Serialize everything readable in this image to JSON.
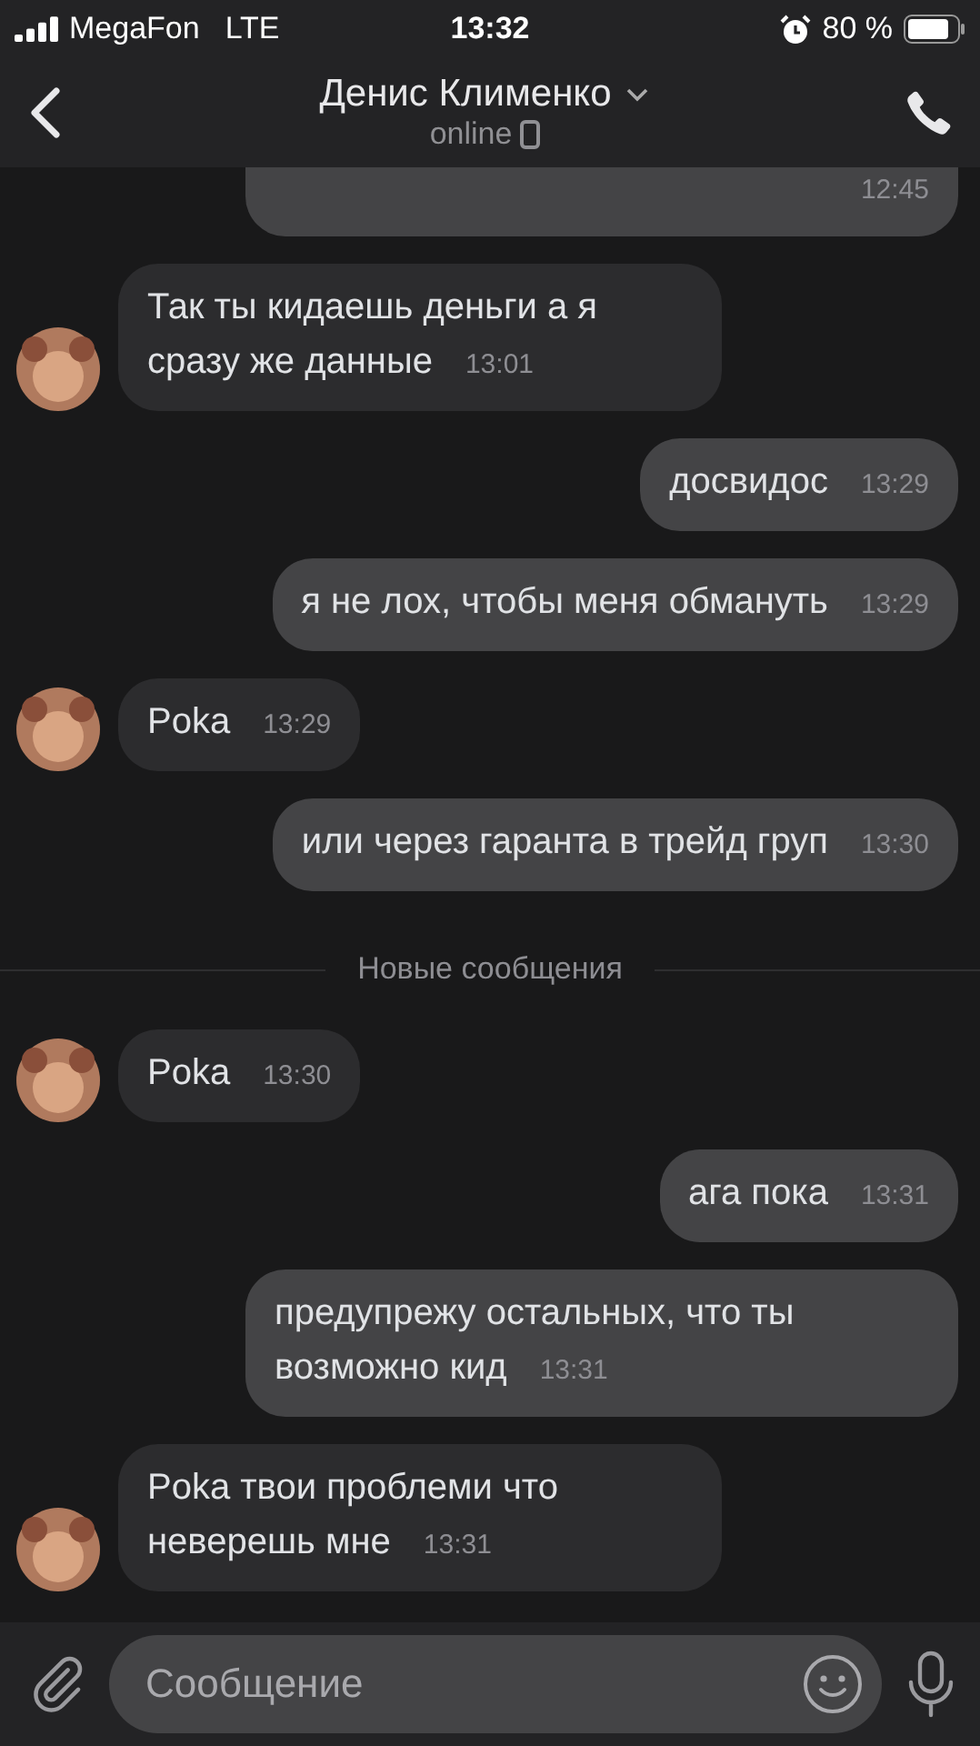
{
  "status_bar": {
    "carrier": "MegaFon",
    "network": "LTE",
    "time": "13:32",
    "battery": "80 %"
  },
  "header": {
    "name": "Денис Клименко",
    "status": "online"
  },
  "messages": [
    {
      "kind": "out",
      "time": "12:45",
      "clipped": true
    },
    {
      "kind": "in",
      "text": "Так ты кидаешь деньги а я сразу же данные",
      "time": "13:01"
    },
    {
      "kind": "out",
      "text": "досвидос",
      "time": "13:29"
    },
    {
      "kind": "out",
      "text": "я не лох, чтобы меня обмануть",
      "time": "13:29"
    },
    {
      "kind": "in",
      "text": "Poka",
      "time": "13:29"
    },
    {
      "kind": "out",
      "text": "или через гаранта в трейд груп",
      "time": "13:30"
    },
    {
      "kind": "divider",
      "text": "Новые сообщения"
    },
    {
      "kind": "in",
      "text": "Poka",
      "time": "13:30"
    },
    {
      "kind": "out",
      "text": "ага пока",
      "time": "13:31"
    },
    {
      "kind": "out",
      "text": "предупрежу остальных, что ты возможно кид",
      "time": "13:31"
    },
    {
      "kind": "in",
      "text": "Poka твои проблеми что неверешь мне",
      "time": "13:31"
    }
  ],
  "composer": {
    "placeholder": "Сообщение"
  }
}
